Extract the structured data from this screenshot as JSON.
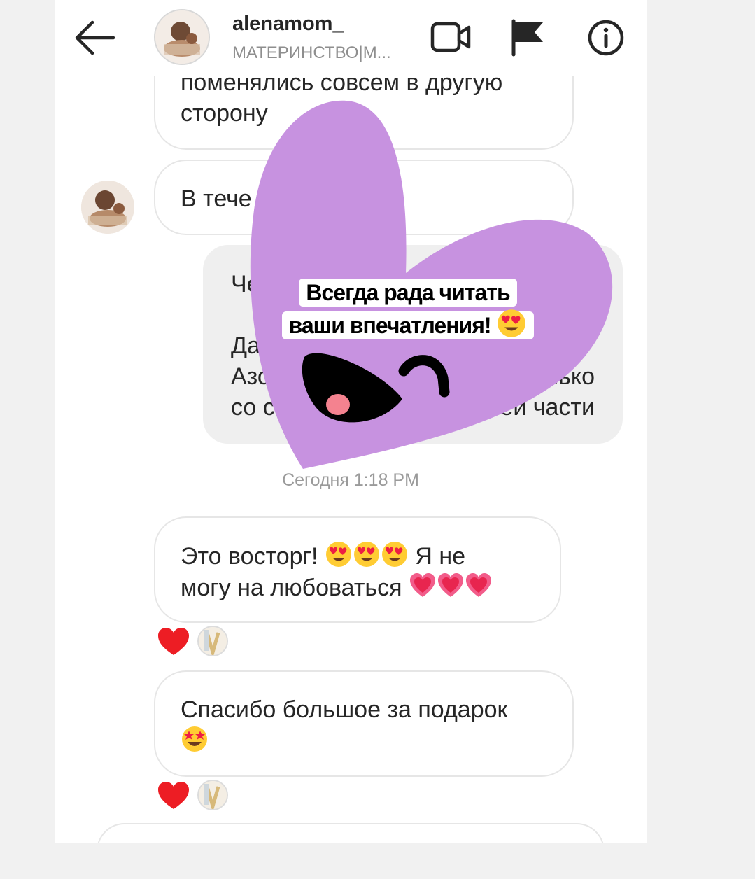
{
  "header": {
    "username": "alenamom_",
    "subtitle": "МАТЕРИНСТВО|М..."
  },
  "messages": {
    "m1_line1": "поменялись совсем в другую",
    "m1_line2": "сторону",
    "m2": "В тече",
    "m3_line1": "Че",
    "m3_line2": "Да",
    "m3_line3_start": "Азо",
    "m3_line3_end": "олько",
    "m3_line4_start": "со с",
    "m3_line4_end": "ей части",
    "m4_part1": "Это восторг!",
    "m4_part2": "Я не",
    "m4_part3": "могу на любоваться",
    "m5": "Спасибо большое за подарок"
  },
  "timestamp": "Сегодня 1:18 PM",
  "sticker": {
    "line1": "Всегда рада читать",
    "line2": "ваши впечатления!",
    "heart_color": "#c792e0"
  },
  "icons": [
    "back-arrow-icon",
    "video-call-icon",
    "flag-icon",
    "info-icon",
    "heart-icon",
    "heart-eyes-emoji",
    "sparkling-heart-emoji",
    "star-struck-emoji"
  ],
  "colors": {
    "reaction_heart": "#ed1d24",
    "bubble_border": "#e6e6e6",
    "received_bg": "#efefef"
  }
}
